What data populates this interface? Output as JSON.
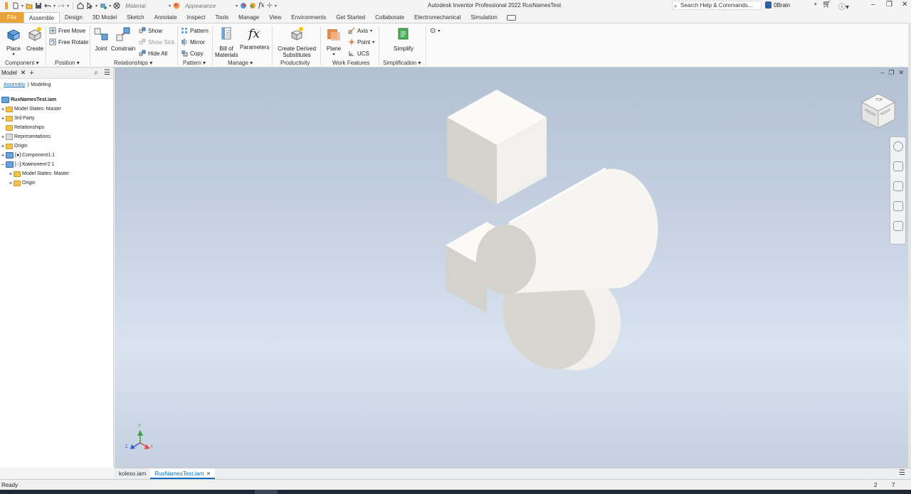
{
  "app": {
    "title": "Autodesk Inventor Professional 2022   RusNamesTest",
    "material_combo": "Material",
    "appearance_combo": "Appearance",
    "search_placeholder": "Search Help & Commands...",
    "user": "0Brain"
  },
  "tabs": [
    "File",
    "Assemble",
    "Design",
    "3D Model",
    "Sketch",
    "Annotate",
    "Inspect",
    "Tools",
    "Manage",
    "View",
    "Environments",
    "Get Started",
    "Collaborate",
    "Electromechanical",
    "Simulation"
  ],
  "active_tab": "Assemble",
  "ribbon": {
    "component": {
      "place": "Place",
      "create": "Create",
      "panel": "Component"
    },
    "position": {
      "free_move": "Free Move",
      "free_rotate": "Free Rotate",
      "panel": "Position"
    },
    "relationships": {
      "joint": "Joint",
      "constrain": "Constrain",
      "show": "Show",
      "show_sick": "Show Sick",
      "hide_all": "Hide All",
      "panel": "Relationships"
    },
    "pattern": {
      "pattern": "Pattern",
      "mirror": "Mirror",
      "copy": "Copy",
      "panel": "Pattern"
    },
    "manage": {
      "bom_line1": "Bill of",
      "bom_line2": "Materials",
      "parameters": "Parameters",
      "panel": "Manage"
    },
    "productivity": {
      "cds_line1": "Create Derived",
      "cds_line2": "Substitutes",
      "panel": "Productivity"
    },
    "work_features": {
      "plane": "Plane",
      "axis": "Axis",
      "point": "Point",
      "ucs": "UCS",
      "panel": "Work Features"
    },
    "simplification": {
      "simplify": "Simplify",
      "panel": "Simplification"
    }
  },
  "browser": {
    "tab_label": "Model",
    "assembly_tab": "Assembly",
    "modeling_tab": "Modeling",
    "tree": [
      {
        "label": "RusNamesTest.iam",
        "icon": "assembly-icon",
        "expander": ""
      },
      {
        "label": "Model States: Master",
        "icon": "folder-icon",
        "expander": "+"
      },
      {
        "label": "3rd Party",
        "icon": "folder-icon",
        "expander": "+"
      },
      {
        "label": "Relationships",
        "icon": "relationships-icon",
        "expander": ""
      },
      {
        "label": "Representations",
        "icon": "folder-icon",
        "expander": "+"
      },
      {
        "label": "Origin",
        "icon": "folder-icon",
        "expander": "+"
      },
      {
        "label": "[●]:Component1:1",
        "icon": "assembly-icon",
        "expander": "+"
      },
      {
        "label": "[○]:Компонент2:1",
        "icon": "assembly-icon",
        "expander": "−"
      },
      {
        "label": "Model States: Master",
        "icon": "folder-icon",
        "expander": "+"
      },
      {
        "label": "Origin",
        "icon": "folder-icon",
        "expander": "+"
      }
    ]
  },
  "viewcube": {
    "top": "TOP",
    "front": "FRONT",
    "right": "RIGHT"
  },
  "triad": {
    "x": "X",
    "y": "Y",
    "z": "Z"
  },
  "doc_tabs": [
    "koleso.iam",
    "RusNamesTest.iam"
  ],
  "active_doc": "RusNamesTest.iam",
  "status": {
    "text": "Ready",
    "count1": "2",
    "count2": "7"
  },
  "colors": {
    "file_tab": "#e8a33a",
    "accent": "#0a6fc2",
    "model_face": "#f1f0ec"
  }
}
